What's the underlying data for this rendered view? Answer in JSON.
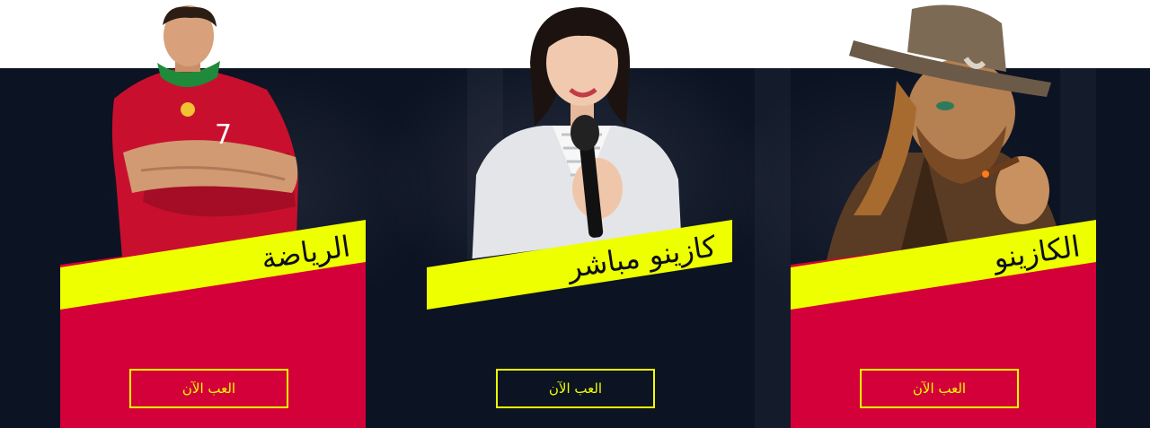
{
  "cards": [
    {
      "title": "الرياضة",
      "button": "العب الآن",
      "panel_color": "#d4003a"
    },
    {
      "title": "كازينو مباشر",
      "button": "العب الآن",
      "panel_color": "#0c1323"
    },
    {
      "title": "الكازينو",
      "button": "العب الآن",
      "panel_color": "#d4003a"
    }
  ],
  "colors": {
    "background_band": "#0c1323",
    "accent": "#eeff00",
    "red": "#d4003a"
  },
  "illustrations": [
    "football-player",
    "live-dealer-presenter",
    "cowboy-slot-character"
  ]
}
